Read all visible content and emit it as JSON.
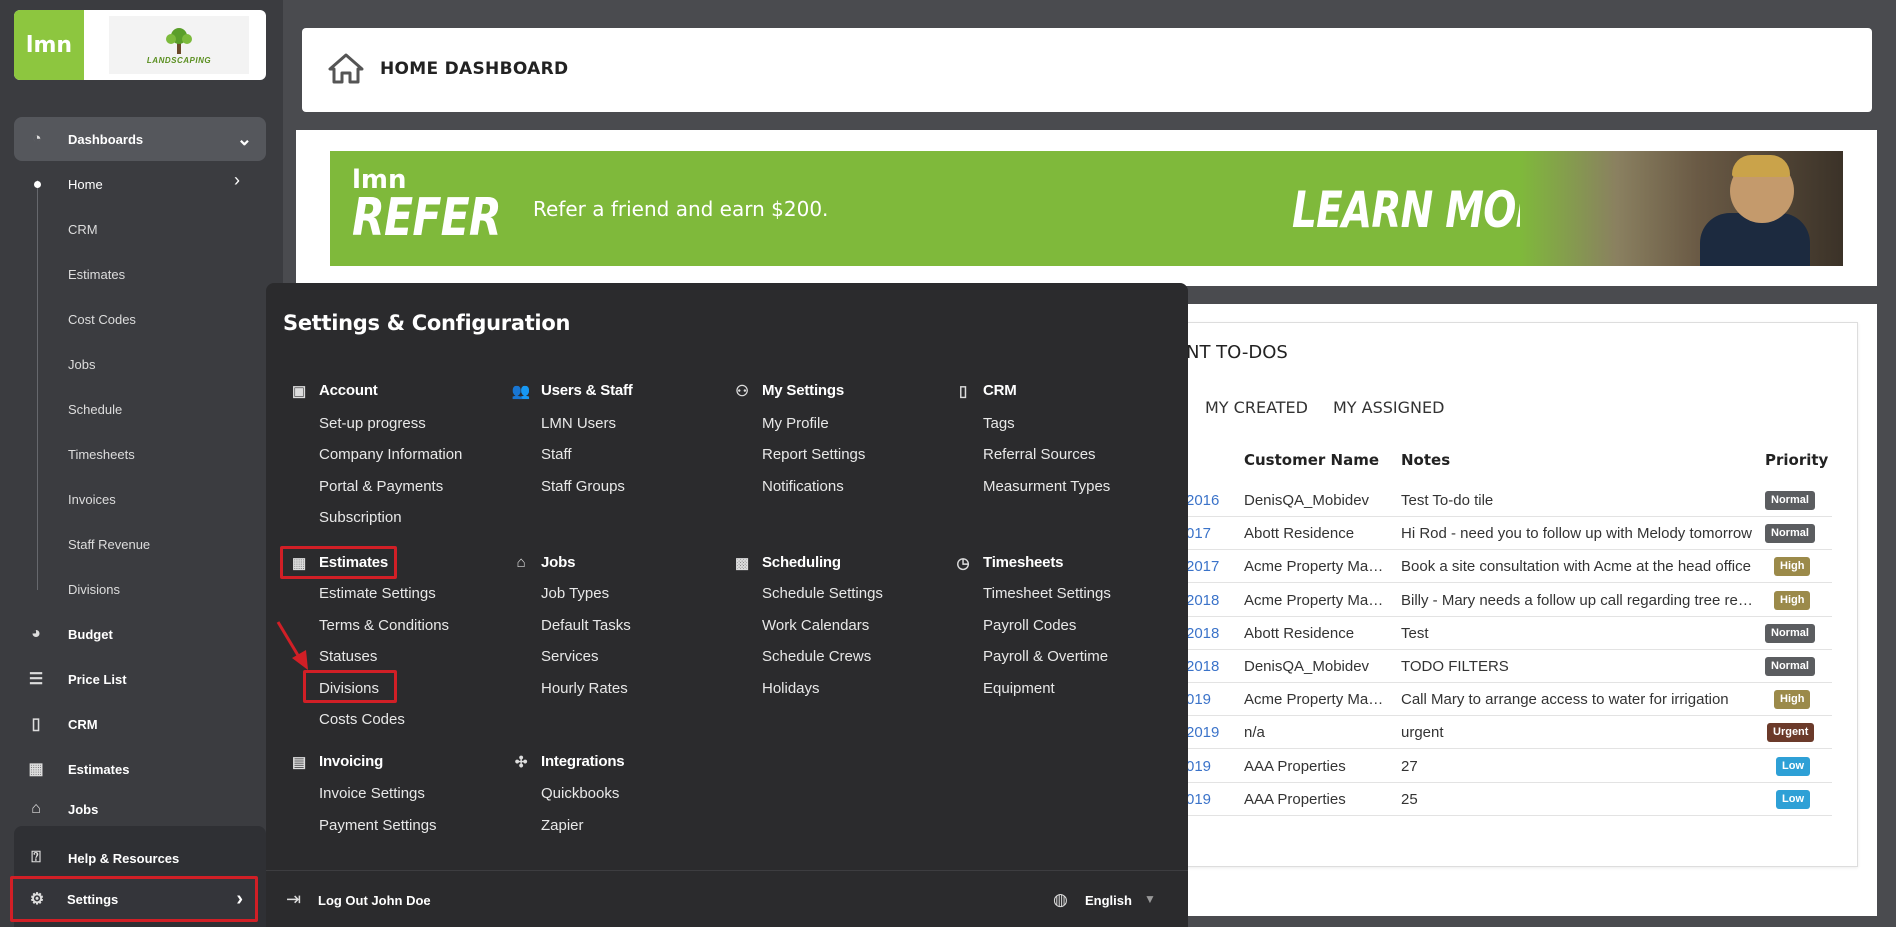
{
  "sidebar": {
    "logo": "lmn",
    "company_logo_text": "LANDSCAPING",
    "dashboards_label": "Dashboards",
    "sub_items": [
      "Home",
      "CRM",
      "Estimates",
      "Cost Codes",
      "Jobs",
      "Schedule",
      "Timesheets",
      "Invoices",
      "Staff Revenue",
      "Divisions"
    ],
    "items": [
      {
        "label": "Budget",
        "icon": "pie-chart-icon"
      },
      {
        "label": "Price List",
        "icon": "list-icon"
      },
      {
        "label": "CRM",
        "icon": "contact-card-icon"
      },
      {
        "label": "Estimates",
        "icon": "calculator-icon"
      },
      {
        "label": "Jobs",
        "icon": "warehouse-icon"
      }
    ],
    "help_label": "Help & Resources",
    "settings_label": "Settings"
  },
  "header": {
    "title": "HOME DASHBOARD"
  },
  "banner": {
    "logo_small": "lmn",
    "logo_big": "REFER",
    "text": "Refer a friend and earn $200.",
    "cta": "LEARN MORE!"
  },
  "todos": {
    "title": "NT TO-DOS",
    "tabs": [
      "MY CREATED",
      "MY ASSIGNED"
    ],
    "columns": {
      "customer": "Customer Name",
      "notes": "Notes",
      "priority": "Priority"
    },
    "rows": [
      {
        "date": "2016",
        "customer": "DenisQA_Mobidev",
        "notes": "Test To-do tile",
        "priority": "Normal"
      },
      {
        "date": "017",
        "customer": "Abott Residence",
        "notes": "Hi Rod - need you to follow up with Melody tomorrow",
        "priority": "Normal"
      },
      {
        "date": "2017",
        "customer": "Acme Property Management",
        "notes": "Book a site consultation with Acme at the head office",
        "priority": "High"
      },
      {
        "date": "2018",
        "customer": "Acme Property Management",
        "notes": "Billy - Mary needs a follow up call regarding tree removal",
        "priority": "High"
      },
      {
        "date": "2018",
        "customer": "Abott Residence",
        "notes": "Test",
        "priority": "Normal"
      },
      {
        "date": "2018",
        "customer": "DenisQA_Mobidev",
        "notes": "TODO FILTERS",
        "priority": "Normal"
      },
      {
        "date": "019",
        "customer": "Acme Property Management",
        "notes": "Call Mary to arrange access to water for irrigation",
        "priority": "High"
      },
      {
        "date": "2019",
        "customer": "n/a",
        "notes": "urgent",
        "priority": "Urgent"
      },
      {
        "date": "019",
        "customer": "AAA Properties",
        "notes": "27",
        "priority": "Low"
      },
      {
        "date": "019",
        "customer": "AAA Properties",
        "notes": "25",
        "priority": "Low"
      }
    ]
  },
  "priority_colors": {
    "Normal": "#5b5d60",
    "High": "#9b8a4a",
    "Urgent": "#6b3a2a",
    "Low": "#2ea0d6"
  },
  "settings_panel": {
    "title": "Settings & Configuration",
    "sections": {
      "account": {
        "title": "Account",
        "items": [
          "Set-up progress",
          "Company Information",
          "Portal & Payments",
          "Subscription"
        ]
      },
      "users": {
        "title": "Users & Staff",
        "items": [
          "LMN Users",
          "Staff",
          "Staff Groups"
        ]
      },
      "my_settings": {
        "title": "My Settings",
        "items": [
          "My Profile",
          "Report Settings",
          "Notifications"
        ]
      },
      "crm": {
        "title": "CRM",
        "items": [
          "Tags",
          "Referral Sources",
          "Measurment Types"
        ]
      },
      "estimates": {
        "title": "Estimates",
        "items": [
          "Estimate Settings",
          "Terms & Conditions",
          "Statuses",
          "Divisions",
          "Costs Codes"
        ]
      },
      "jobs": {
        "title": "Jobs",
        "items": [
          "Job Types",
          "Default Tasks",
          "Services",
          "Hourly Rates"
        ]
      },
      "scheduling": {
        "title": "Scheduling",
        "items": [
          "Schedule Settings",
          "Work Calendars",
          "Schedule Crews",
          "Holidays"
        ]
      },
      "timesheets": {
        "title": "Timesheets",
        "items": [
          "Timesheet Settings",
          "Payroll Codes",
          "Payroll & Overtime",
          "Equipment"
        ]
      },
      "invoicing": {
        "title": "Invoicing",
        "items": [
          "Invoice Settings",
          "Payment Settings"
        ]
      },
      "integrations": {
        "title": "Integrations",
        "items": [
          "Quickbooks",
          "Zapier"
        ]
      }
    },
    "footer": {
      "logout": "Log Out John Doe",
      "language": "English"
    }
  },
  "colors": {
    "highlight": "#d11f26",
    "brand_green": "#8dc63f"
  }
}
